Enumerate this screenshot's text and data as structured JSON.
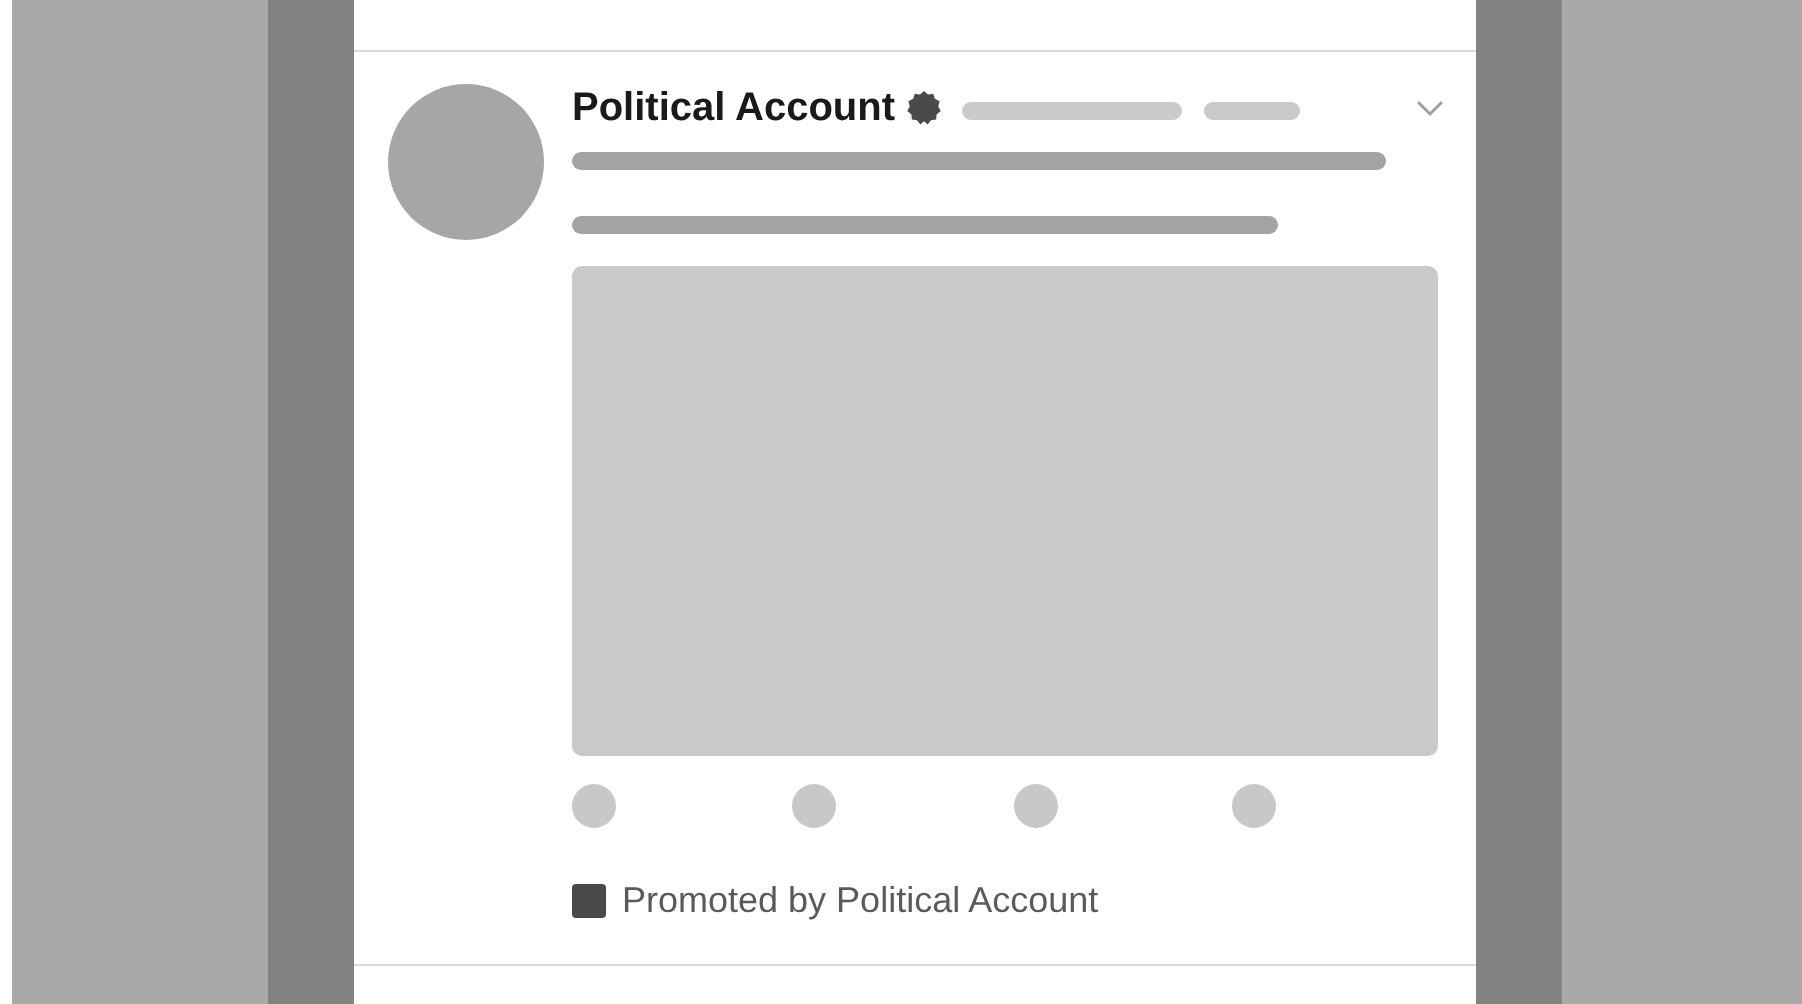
{
  "tweet": {
    "author": "Political Account",
    "promoted_label": "Promoted by Political Account"
  }
}
